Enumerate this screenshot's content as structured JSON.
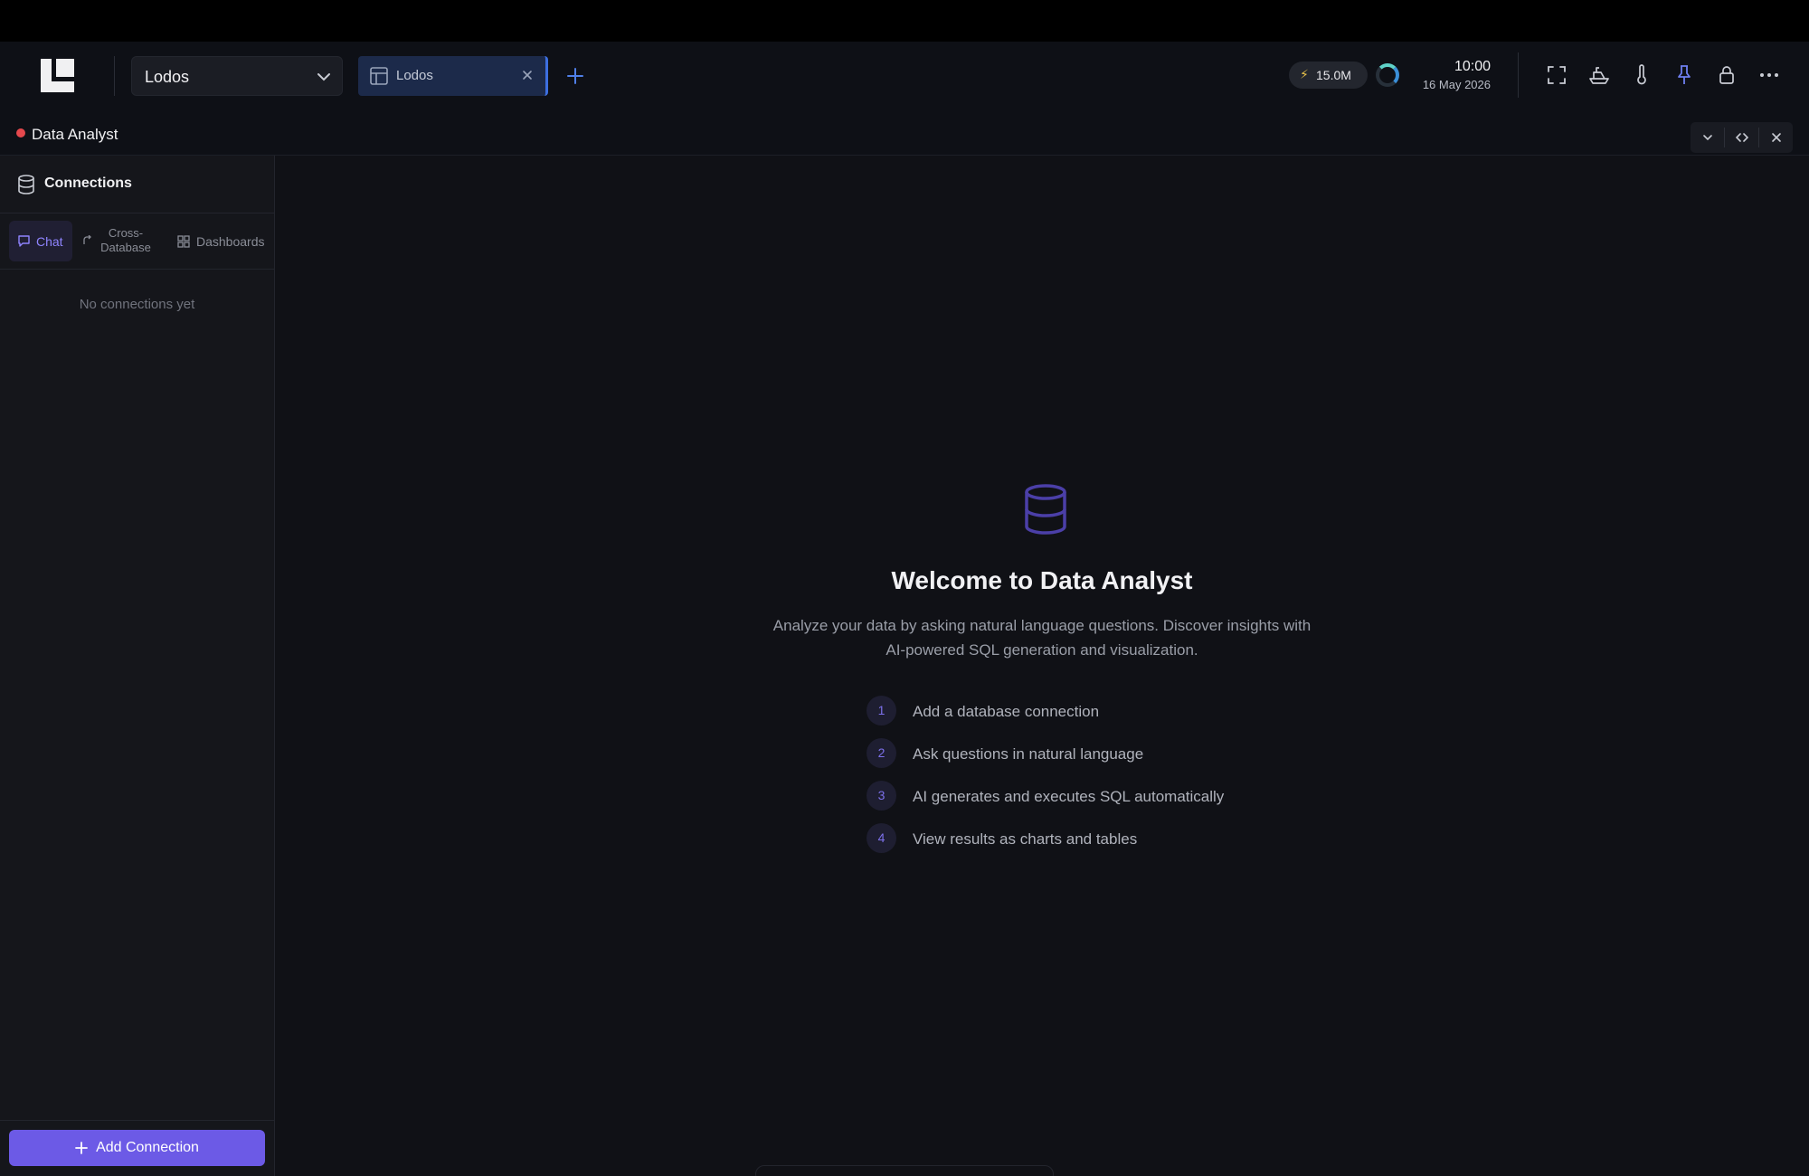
{
  "header": {
    "workspace": "Lodos",
    "tab_label": "Lodos",
    "token_usage": "15.0M",
    "time": "10:00",
    "date": "16 May 2026"
  },
  "panel": {
    "title": "Data Analyst",
    "status_color": "#e5484d"
  },
  "sidebar": {
    "heading": "Connections",
    "tabs": [
      {
        "label": "Chat",
        "icon": "chat-icon",
        "active": true
      },
      {
        "label": "Cross-Database",
        "icon": "cross-database-icon",
        "active": false
      },
      {
        "label": "Dashboards",
        "icon": "dashboard-grid-icon",
        "active": false
      }
    ],
    "empty_text": "No connections yet",
    "add_button": "Add Connection"
  },
  "main": {
    "icon": "database-icon",
    "welcome_title": "Welcome to Data Analyst",
    "description": "Analyze your data by asking natural language questions. Discover insights with AI-powered SQL generation and visualization.",
    "steps": [
      {
        "num": "1",
        "text": "Add a database connection"
      },
      {
        "num": "2",
        "text": "Ask questions in natural language"
      },
      {
        "num": "3",
        "text": "AI generates and executes SQL automatically"
      },
      {
        "num": "4",
        "text": "View results as charts and tables"
      }
    ]
  },
  "colors": {
    "accent": "#6c5ae6",
    "tab_accent": "#3d6fe0",
    "background": "#101116"
  }
}
